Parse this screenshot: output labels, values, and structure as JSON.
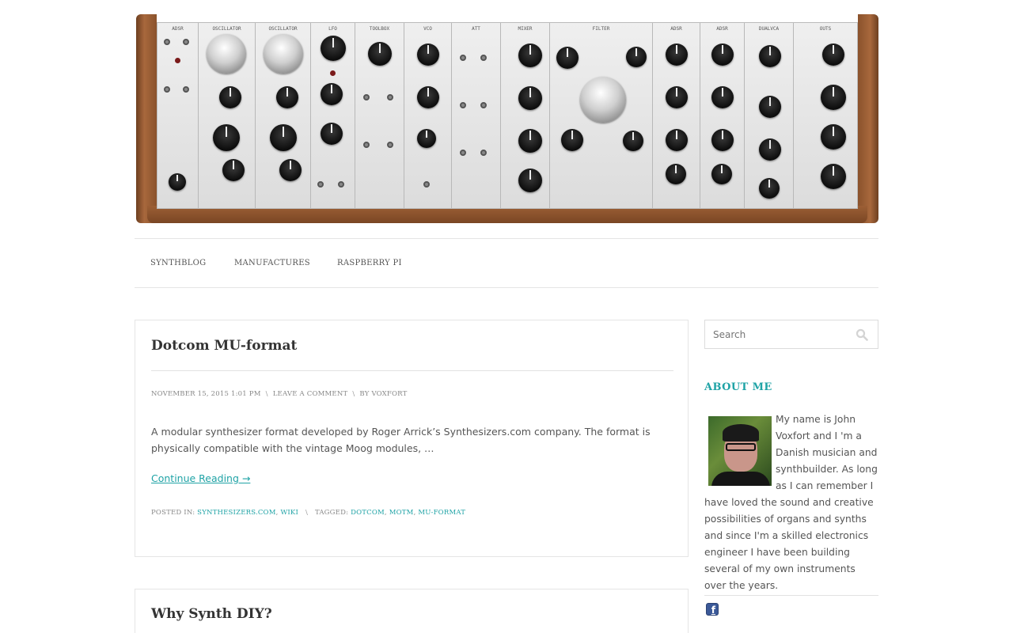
{
  "nav": {
    "items": [
      {
        "label": "SYNTHBLOG"
      },
      {
        "label": "MANUFACTURES"
      },
      {
        "label": "RASPBERRY PI"
      }
    ]
  },
  "posts": [
    {
      "title": "Dotcom MU-format",
      "date": "NOVEMBER 15, 2015 1:01 PM",
      "comment_link": "LEAVE A COMMENT",
      "by_prefix": "BY",
      "author": "VOXFORT",
      "excerpt": "A modular synthesizer format developed by Roger Arrick’s Synthesizers.com company. The format is physically compatible with the vintage Moog modules, …",
      "continue_label": "Continue Reading →",
      "posted_in_prefix": "POSTED IN:",
      "categories": [
        "SYNTHESIZERS.COM",
        "WIKI"
      ],
      "tagged_prefix": "TAGGED:",
      "tags": [
        "DOTCOM",
        "MOTM",
        "MU-FORMAT"
      ]
    },
    {
      "title": "Why Synth DIY?"
    }
  ],
  "sidebar": {
    "search_placeholder": "Search",
    "about_title": "ABOUT ME",
    "about_text": "My name is John Voxfort and I 'm a Danish musician and synthbuilder. As long as I can remember I have loved the sound and creative possibilities of organs and synths and since I'm a skilled electronics engineer I have been building several of my own instruments over the years."
  },
  "header": {
    "module_labels": [
      "ADSR",
      "OSCILLATOR",
      "OSCILLATOR",
      "LFO",
      "TOOLBOX",
      "VCO",
      "ATT",
      "MIXER",
      "FILTER",
      "ADSR",
      "ADSR",
      "DUALVCA",
      "OUTS"
    ]
  },
  "colors": {
    "accent": "#1fa3a6"
  }
}
